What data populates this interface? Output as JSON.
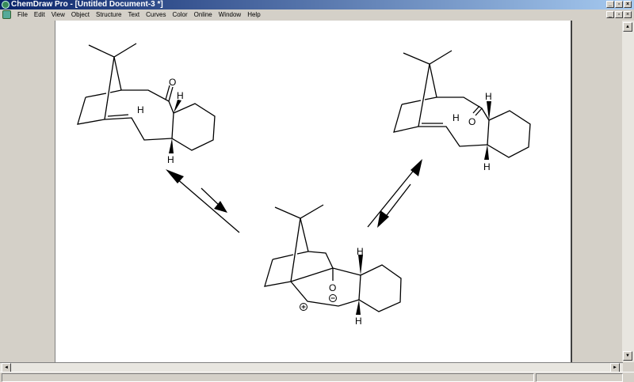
{
  "window": {
    "title": "ChemDraw Pro - [Untitled Document-3 *]",
    "controls": {
      "minimize": "_",
      "restore": "▫",
      "close": "×"
    }
  },
  "menu": [
    "File",
    "Edit",
    "View",
    "Object",
    "Structure",
    "Text",
    "Curves",
    "Color",
    "Online",
    "Window",
    "Help"
  ],
  "atoms": {
    "o": "O",
    "h": "H",
    "plus": "+",
    "minus": "−"
  },
  "scroll": {
    "up": "▲",
    "down": "▼",
    "left": "◄",
    "right": "►"
  }
}
